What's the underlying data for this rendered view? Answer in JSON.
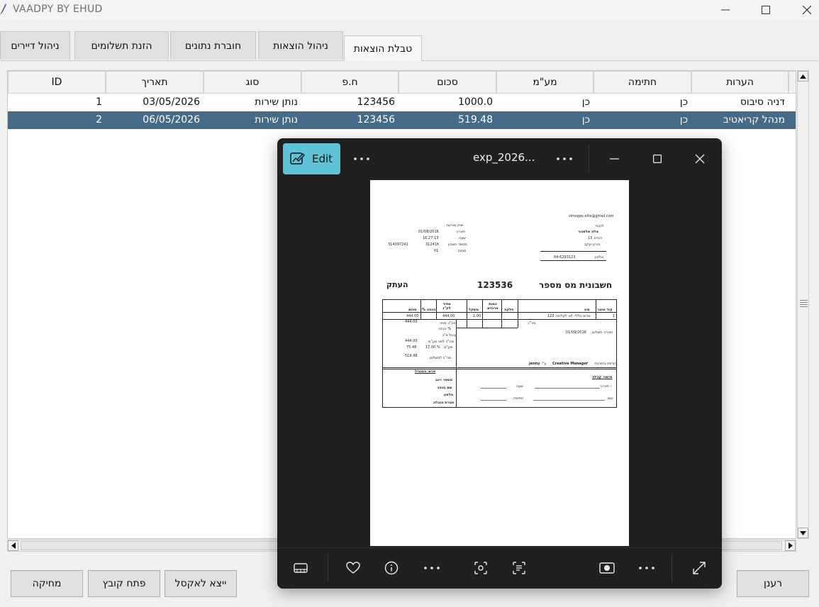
{
  "window": {
    "title": "VAADPY BY EHUD"
  },
  "tabs": [
    {
      "label": "ניהול דיירים"
    },
    {
      "label": "הזנת תשלומים"
    },
    {
      "label": "חוברת נתונים"
    },
    {
      "label": "ניהול הוצאות"
    },
    {
      "label": "טבלת הוצאות"
    }
  ],
  "table": {
    "columns": [
      "ID",
      "תאריך",
      "סוג",
      "ח.פ",
      "סכום",
      "מע\"מ",
      "חתימה",
      "הערות"
    ],
    "rows": [
      {
        "id": "1",
        "date": "03/05/2026",
        "type": "נותן שירות",
        "hp": "123456",
        "amount": "1000.0",
        "vat": "כן",
        "signature": "כן",
        "notes": "דניה סיבוס"
      },
      {
        "id": "2",
        "date": "06/05/2026",
        "type": "נותן שירות",
        "hp": "123456",
        "amount": "519.48",
        "vat": "כן",
        "signature": "כן",
        "notes": "מנהל קריאטיב"
      }
    ]
  },
  "buttons": {
    "delete": "מחיקה",
    "open_file": "פתח קובץ",
    "export_excel": "ייצא לאקסל",
    "refresh": "רענן"
  },
  "viewer": {
    "edit_label": "Edit",
    "filename": "exp_2026...",
    "document": {
      "email": "slmogox.ellis@gmail.com",
      "to_label": "לכבוד",
      "customer_name": "אלה אלמגור",
      "address1": "הנדיב 13",
      "address2": "זכרון יעקב",
      "phone_label": "טלפון",
      "phone": "04-6293123",
      "agent_label": "שוק מורשה",
      "date_label": "תאריך",
      "date_value": "01/08/2016",
      "time_label": "שעה",
      "time_value": "16:27:13",
      "account_label": "מספר חשבון",
      "account_value": "312416",
      "branch_label": "מחסן",
      "branch_value": "01",
      "id_value": "314397241",
      "title": "חשבונית מס מספר",
      "number": "123536",
      "copy_label": "העתק",
      "col_code": "קוד מוצר",
      "col_desc": "סוג",
      "col_part": "חלקה",
      "col_qty": "כמות ארגזים",
      "col_weight": "משקל",
      "col_price": "מחיר לק\"ג",
      "col_discount": "% הנחה",
      "col_total": "סכום",
      "item_code": "1",
      "item_desc": "סרים כללי- לא לקליפה 123",
      "item_weight": "1.00",
      "item_price": "444.00",
      "item_total": "444.00",
      "total_label": "סה\"כ",
      "sum_price_label": "סה\"כ מחיר",
      "sum_price": "444.00",
      "discount_label": "הנחה %",
      "rounding_label": "עיגול א\"ג",
      "before_vat_label": "סה\"כ לפני מע\"מ",
      "before_vat": "444.00",
      "vat_label": "מע\"מ",
      "vat_rate": "17.00 %",
      "vat_amount": "75.48",
      "to_pay_label": "סה\"כ לתשלום",
      "to_pay": "519.48",
      "pay_date_label": "תאריך תשלום",
      "pay_date": "01/09/2016",
      "printed_by": "הודפס בתוכנת",
      "manager": "Creative Manager",
      "by_label": "ע\"י",
      "user": "jenny",
      "driver_title": "פרטי המוביל",
      "car_label": "מספר רכב",
      "driver_label": "שם הנהג",
      "dphone_label": "טלפון",
      "company_label": "חברת הובלה",
      "receipt_title": "אישור קבלה",
      "rdate_label": "תאריך :",
      "rtime_label": "שעה",
      "rname_label": "שם:",
      "rsign_label": "חתימה"
    }
  }
}
